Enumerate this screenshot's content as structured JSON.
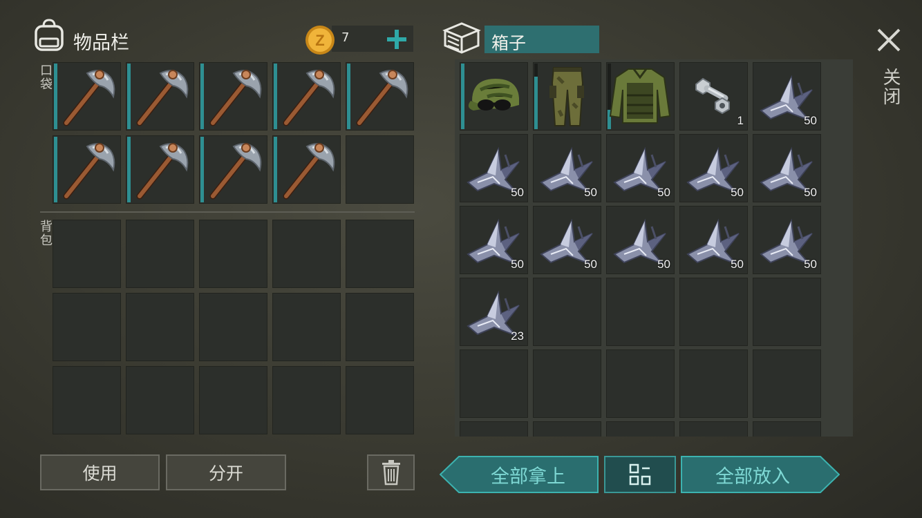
{
  "inventory": {
    "title": "物品栏",
    "coins": "7",
    "pocket_label": "口袋",
    "backpack_label": "背包",
    "pocket_slots": [
      {
        "item": "pickaxe-icon"
      },
      {
        "item": "pickaxe-icon"
      },
      {
        "item": "pickaxe-icon"
      },
      {
        "item": "pickaxe-icon"
      },
      {
        "item": "pickaxe-icon"
      },
      {
        "item": "pickaxe-icon"
      },
      {
        "item": "pickaxe-icon"
      },
      {
        "item": "pickaxe-icon"
      },
      {
        "item": "pickaxe-icon"
      },
      {
        "item": ""
      }
    ],
    "backpack_slot_count": 15
  },
  "container": {
    "title": "箱子",
    "slots": [
      {
        "item": "cap-icon",
        "count": ""
      },
      {
        "item": "pants-icon",
        "count": ""
      },
      {
        "item": "jacket-icon",
        "count": ""
      },
      {
        "item": "bolt-nut-icon",
        "count": "1"
      },
      {
        "item": "scrap-metal-icon",
        "count": "50"
      },
      {
        "item": "scrap-metal-icon",
        "count": "50"
      },
      {
        "item": "scrap-metal-icon",
        "count": "50"
      },
      {
        "item": "scrap-metal-icon",
        "count": "50"
      },
      {
        "item": "scrap-metal-icon",
        "count": "50"
      },
      {
        "item": "scrap-metal-icon",
        "count": "50"
      },
      {
        "item": "scrap-metal-icon",
        "count": "50"
      },
      {
        "item": "scrap-metal-icon",
        "count": "50"
      },
      {
        "item": "scrap-metal-icon",
        "count": "50"
      },
      {
        "item": "scrap-metal-icon",
        "count": "50"
      },
      {
        "item": "scrap-metal-icon",
        "count": "50"
      },
      {
        "item": "scrap-metal-icon",
        "count": "23"
      },
      {
        "item": "",
        "count": ""
      },
      {
        "item": "",
        "count": ""
      },
      {
        "item": "",
        "count": ""
      },
      {
        "item": "",
        "count": ""
      },
      {
        "item": "",
        "count": ""
      },
      {
        "item": "",
        "count": ""
      },
      {
        "item": "",
        "count": ""
      },
      {
        "item": "",
        "count": ""
      },
      {
        "item": "",
        "count": ""
      }
    ]
  },
  "buttons": {
    "use": "使用",
    "split": "分开",
    "take_all": "全部拿上",
    "put_all": "全部放入",
    "close": "关闭"
  },
  "colors": {
    "accent": "#2e8f92",
    "button_text": "#7ed8d4"
  }
}
